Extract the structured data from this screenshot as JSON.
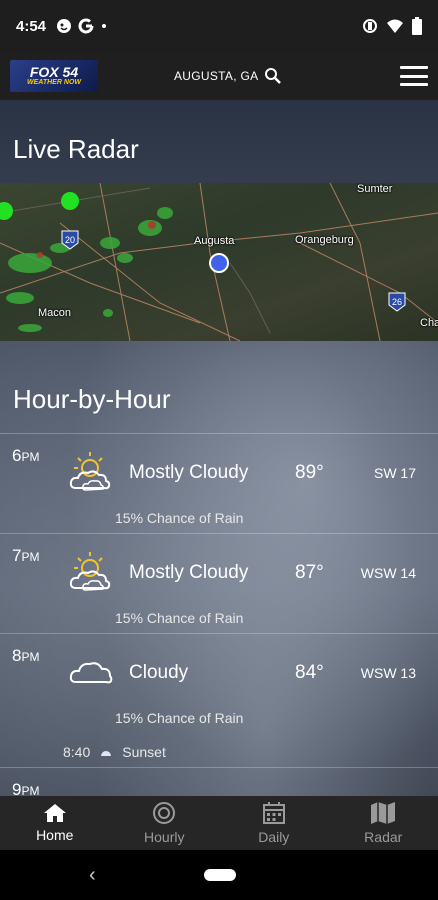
{
  "status_bar": {
    "time": "4:54",
    "icons": [
      "theater-icon",
      "google-icon",
      "dot-icon"
    ],
    "right_icons": [
      "vibrate-icon",
      "wifi-icon",
      "battery-icon"
    ]
  },
  "header": {
    "logo_line1": "FOX 54",
    "logo_line2": "WEATHER NOW",
    "location": "AUGUSTA, GA"
  },
  "radar": {
    "title": "Live Radar",
    "cities": [
      "Sumter",
      "Augusta",
      "Orangeburg",
      "Macon",
      "Cha"
    ],
    "highways": [
      "20",
      "26"
    ]
  },
  "hourly": {
    "title": "Hour-by-Hour",
    "rows": [
      {
        "hour": "6",
        "ampm": "PM",
        "icon": "partly-cloudy-sun-icon",
        "condition": "Mostly Cloudy",
        "temp": "89°",
        "wind": "SW 17",
        "rain": "15% Chance of Rain"
      },
      {
        "hour": "7",
        "ampm": "PM",
        "icon": "partly-cloudy-sun-icon",
        "condition": "Mostly Cloudy",
        "temp": "87°",
        "wind": "WSW 14",
        "rain": "15% Chance of Rain"
      },
      {
        "hour": "8",
        "ampm": "PM",
        "icon": "cloud-icon",
        "condition": "Cloudy",
        "temp": "84°",
        "wind": "WSW 13",
        "rain": "15% Chance of Rain",
        "sunset_time": "8:40",
        "sunset_label": "Sunset"
      },
      {
        "hour": "9",
        "ampm": "PM"
      }
    ]
  },
  "tabs": [
    {
      "label": "Home",
      "icon": "home-icon",
      "active": true
    },
    {
      "label": "Hourly",
      "icon": "clock-icon",
      "active": false
    },
    {
      "label": "Daily",
      "icon": "calendar-icon",
      "active": false
    },
    {
      "label": "Radar",
      "icon": "map-icon",
      "active": false
    }
  ],
  "nav": {
    "back": "‹"
  }
}
